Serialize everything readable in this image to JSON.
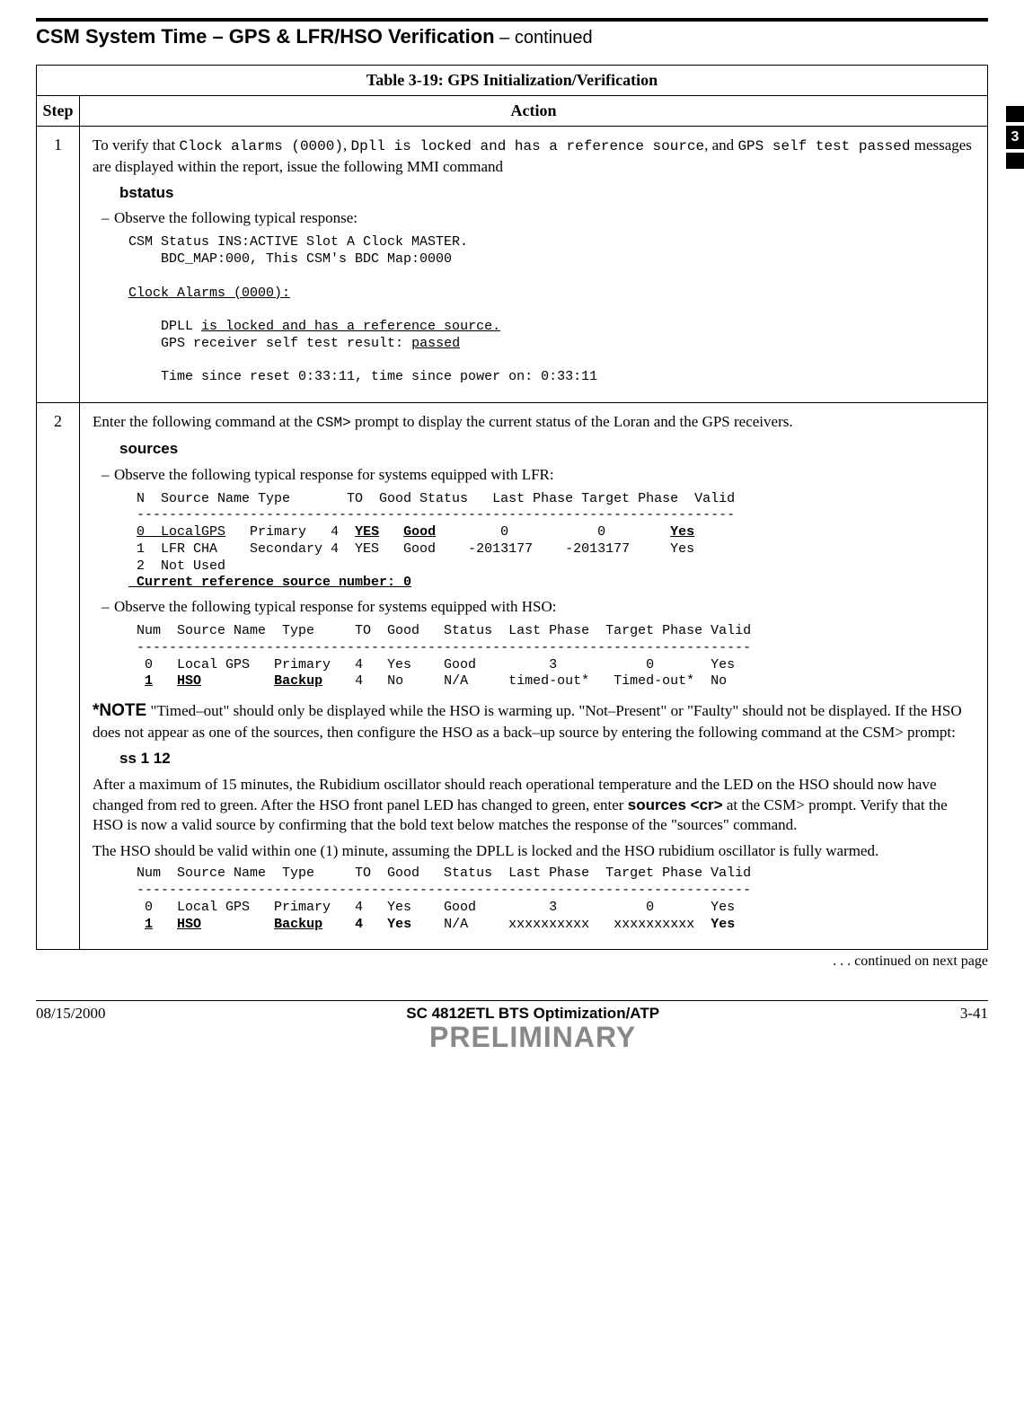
{
  "page_title_main": "CSM System Time – GPS & LFR/HSO Verification",
  "page_title_cont": " – continued",
  "side_tab": "3",
  "table_caption_label": "Table 3-19:",
  "table_caption_text": " GPS Initialization/Verification",
  "hdr_step": "Step",
  "hdr_action": "Action",
  "step1_num": "1",
  "step1_intro_a": "To verify that ",
  "step1_intro_b": "Clock alarms (0000)",
  "step1_intro_c": ", ",
  "step1_intro_d": "Dpll is locked and has a reference source",
  "step1_intro_e": ", and ",
  "step1_intro_f": "GPS self test passed",
  "step1_intro_g": " messages are displayed within the report,  issue the following MMI command",
  "step1_cmd": "bstatus",
  "step1_bullet": "Observe the following typical response:",
  "step1_l1": "CSM Status INS:ACTIVE Slot A Clock MASTER.",
  "step1_l2": "    BDC_MAP:000, This CSM's BDC Map:0000",
  "step1_l3": "Clock Alarms (0000):",
  "step1_l4a": "    DPLL ",
  "step1_l4b": "is locked and has a reference source.",
  "step1_l5a": "    GPS receiver self test result: ",
  "step1_l5b": "passed",
  "step1_l6": "    Time since reset 0:33:11, time since power on: 0:33:11",
  "step2_num": "2",
  "step2_intro_a": "Enter the following command at the ",
  "step2_intro_b": "CSM>",
  "step2_intro_c": " prompt to display the current status of the Loran and the GPS receivers.",
  "step2_cmd1": "sources",
  "step2_bullet1": "Observe the following typical response for systems equipped with LFR:",
  "lfr_hdr": " N  Source Name Type       TO  Good Status   Last Phase Target Phase  Valid",
  "lfr_rule": " --------------------------------------------------------------------------",
  "lfr_r0_a": " ",
  "lfr_r0_b": "0  LocalGPS",
  "lfr_r0_c": "   Primary   4  ",
  "lfr_r0_d": "YES",
  "lfr_r0_e": "   ",
  "lfr_r0_f": "Good",
  "lfr_r0_g": "        0           0        ",
  "lfr_r0_h": "Yes",
  "lfr_r1": " 1  LFR CHA    Secondary 4  YES   Good    -2013177    -2013177     Yes",
  "lfr_r2": " 2  Not Used",
  "lfr_cur": " Current reference source number: 0",
  "step2_bullet2": "Observe the following typical response for systems equipped with HSO:",
  "hso_hdr": " Num  Source Name  Type     TO  Good   Status  Last Phase  Target Phase Valid",
  "hso_rule": " ----------------------------------------------------------------------------",
  "hso_r0": "  0   Local GPS   Primary   4   Yes    Good         3           0       Yes",
  "hso_r1_a": "  ",
  "hso_r1_b": "1",
  "hso_r1_c": "   ",
  "hso_r1_d": "HSO",
  "hso_r1_e": "         ",
  "hso_r1_f": "Backup",
  "hso_r1_g": "    4   No     N/A     timed-out*   Timed-out*  No",
  "note_lead": "*NOTE",
  "note_body": " \"Timed–out\" should only be displayed while the HSO is warming up.  \"Not–Present\" or \"Faulty\" should not be displayed.  If the HSO does not appear as one of the sources, then configure the HSO as a back–up source by entering the following command at the CSM> prompt:",
  "step2_cmd2": "ss  1  12",
  "para_after_a": "After a maximum of 15 minutes, the Rubidium oscillator should reach operational temperature and the LED on the HSO should now have changed from red to green.  After the HSO front panel LED has changed to green, enter ",
  "para_after_b": "sources <cr>",
  "para_after_c": " at the CSM> prompt.  Verify that the HSO is now a valid source by confirming that the bold text below matches the response of the \"sources\" command.",
  "para_after2": "The HSO should be valid within one (1) minute, assuming the DPLL is locked and the HSO rubidium oscillator is fully warmed.",
  "hso2_hdr": " Num  Source Name  Type     TO  Good   Status  Last Phase  Target Phase Valid",
  "hso2_rule": " ----------------------------------------------------------------------------",
  "hso2_r0": "  0   Local GPS   Primary   4   Yes    Good         3           0       Yes",
  "hso2_r1_a": "  ",
  "hso2_r1_b": "1",
  "hso2_r1_c": "   ",
  "hso2_r1_d": "HSO",
  "hso2_r1_e": "         ",
  "hso2_r1_f": "Backup",
  "hso2_r1_g": "    ",
  "hso2_r1_h": "4",
  "hso2_r1_i": "   ",
  "hso2_r1_j": "Yes",
  "hso2_r1_k": "    N/A     xxxxxxxxxx   xxxxxxxxxx  ",
  "hso2_r1_l": "Yes",
  "cont_text": " . . . continued on next page",
  "footer_date": "08/15/2000",
  "footer_center": "SC 4812ETL BTS Optimization/ATP",
  "footer_prelim": "PRELIMINARY",
  "footer_page": "3-41"
}
